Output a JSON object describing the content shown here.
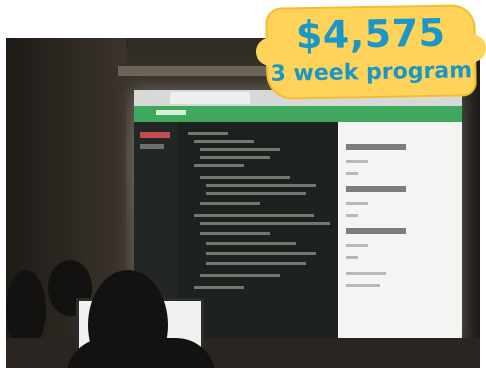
{
  "badge": {
    "price": "$4,575",
    "subtitle": "3 week program"
  },
  "colors": {
    "badge_fill": "#ffd35a",
    "badge_text": "#1a96c7",
    "app_header": "#3fa85c"
  }
}
